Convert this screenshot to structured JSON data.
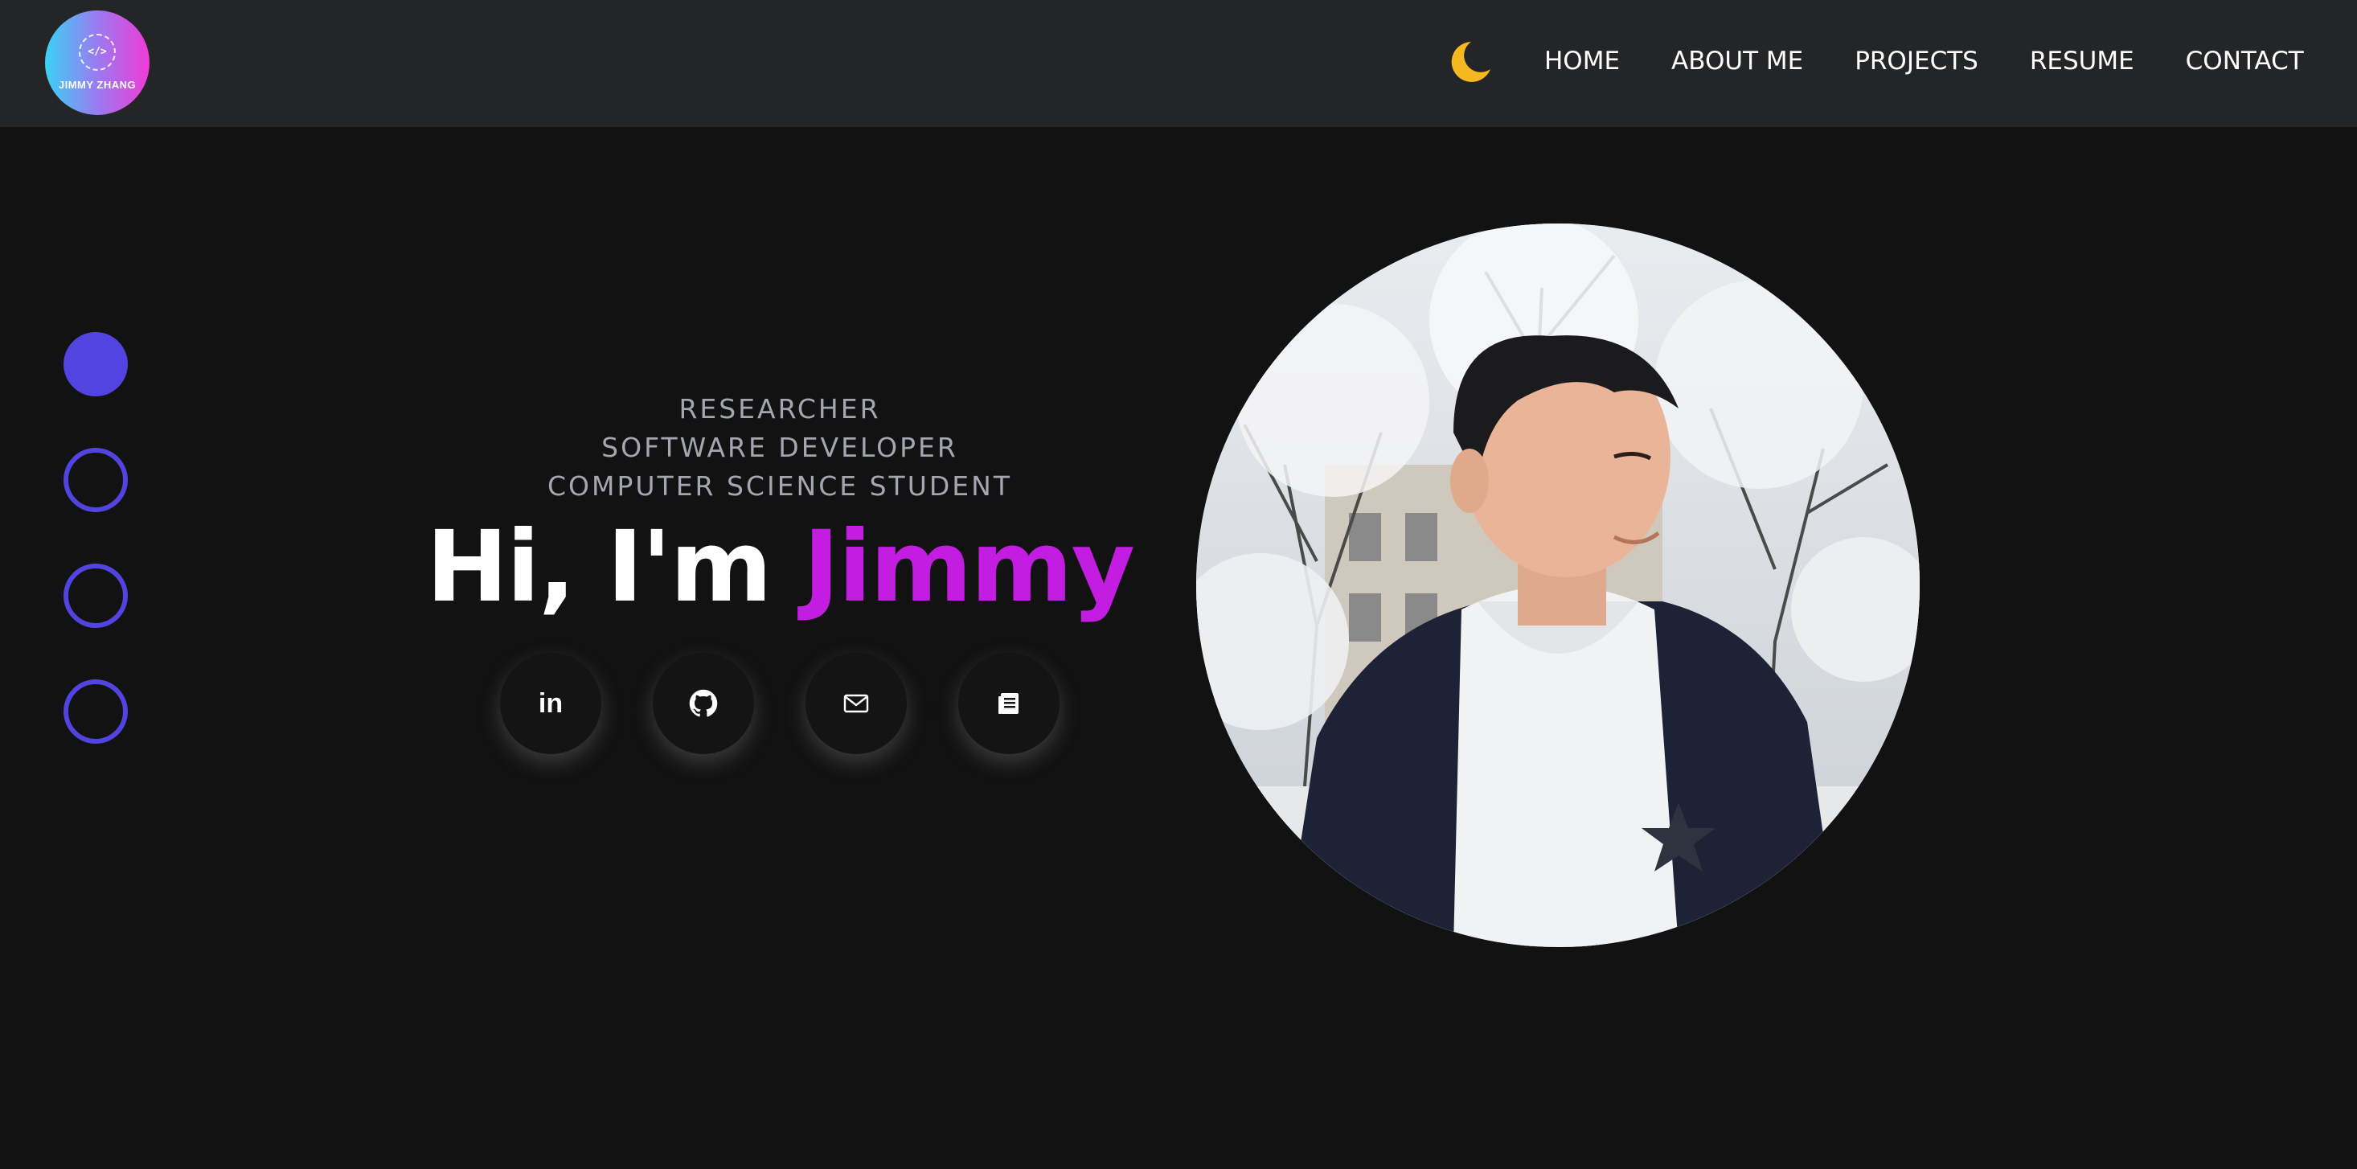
{
  "brand": {
    "logo_text": "JIMMY ZHANG",
    "logo_glyph": "</>"
  },
  "nav": {
    "theme_toggle_icon": "moon-icon",
    "items": [
      {
        "label": "HOME"
      },
      {
        "label": "ABOUT ME"
      },
      {
        "label": "PROJECTS"
      },
      {
        "label": "RESUME"
      },
      {
        "label": "CONTACT"
      }
    ]
  },
  "section_dots": {
    "count": 4,
    "active_index": 0
  },
  "hero": {
    "roles": [
      "RESEARCHER",
      "SOFTWARE DEVELOPER",
      "COMPUTER SCIENCE STUDENT"
    ],
    "greeting": "Hi, I'm",
    "name": "Jimmy",
    "socials": [
      {
        "name": "linkedin-icon",
        "glyph": "in"
      },
      {
        "name": "github-icon"
      },
      {
        "name": "mail-icon"
      },
      {
        "name": "resume-icon"
      }
    ]
  },
  "colors": {
    "nav_bg": "#242527",
    "page_bg": "#121213",
    "accent_name": "#c21de0",
    "dot_color": "#5244e0",
    "moon": "#f5b821"
  }
}
